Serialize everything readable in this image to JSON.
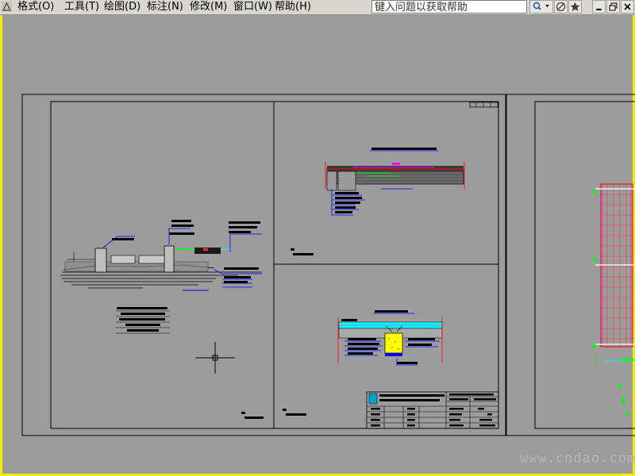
{
  "app": {
    "icon": "autocad-app-icon",
    "menus": [
      {
        "label": "格式(O)"
      },
      {
        "label": "工具(T)"
      },
      {
        "label": "绘图(D)"
      },
      {
        "label": "标注(N)"
      },
      {
        "label": "修改(M)"
      },
      {
        "label": "窗口(W)"
      },
      {
        "label": "帮助(H)"
      }
    ]
  },
  "help_search": {
    "placeholder": "键入问题以获取帮助"
  },
  "toolbar_buttons": [
    {
      "icon": "search-dropdown-icon"
    },
    {
      "icon": "communication-center-icon"
    },
    {
      "icon": "favorites-star-icon"
    }
  ],
  "window_controls": [
    {
      "icon": "minimize-icon"
    },
    {
      "icon": "restore-icon"
    },
    {
      "icon": "close-icon"
    }
  ],
  "colors": {
    "frame_highlight": "#f2ee00",
    "drawing_background": "#9c9c9c",
    "line_black": "#000000",
    "line_red": "#ff0000",
    "line_blue": "#0000ff",
    "line_magenta": "#ff00ff",
    "line_cyan": "#00ffff",
    "line_green": "#00ff00",
    "fill_yellow": "#ffff00",
    "line_white": "#ffffff"
  },
  "watermark": {
    "text": "www.cndao.com"
  }
}
